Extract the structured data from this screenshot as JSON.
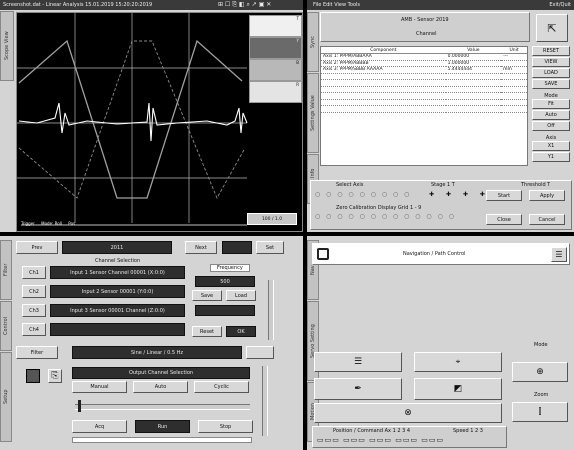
{
  "titlebar_left": {
    "title": "Screenshot.dat - Linear Analysis 15.01.2019 15:20:20:2019"
  },
  "titlebar_right": {
    "title": "File Edit View Tools",
    "right_label": "Exit/Quit"
  },
  "scope": {
    "side_tab": "Scope View",
    "legend": [
      "T",
      "Y",
      "B",
      "R"
    ],
    "colors": {
      "screen": "#000000",
      "grid": "#b8b8b8",
      "trace": "#ffffff",
      "ramp": "#a0a0a0"
    },
    "status_left": "Trigger  ...  Mode: Roll  ...  Pos",
    "zoom_label": "100 / 1.0"
  },
  "table_panel": {
    "side_tabs": [
      "Sync",
      "Settings Value",
      "Plot Info"
    ],
    "header_title": "AMB - Sensor 2019",
    "header_sub": "Channel",
    "columns": [
      "Component",
      "Value",
      "Unit"
    ],
    "rows": [
      {
        "c": "Axis 1: PPPM/ABBAAA",
        "v": "0.000000",
        "u": "---"
      },
      {
        "c": "Axis 2: PPPM/ABBBB",
        "v": "1.000000",
        "u": ""
      },
      {
        "c": "Axis 3: PPPM/SBBB AAAAA",
        "v": "5.4444444",
        "u": "mm"
      },
      {
        "c": "",
        "v": "",
        "u": ""
      },
      {
        "c": "",
        "v": "",
        "u": ""
      },
      {
        "c": "",
        "v": "",
        "u": ""
      },
      {
        "c": "",
        "v": "",
        "u": ""
      },
      {
        "c": "",
        "v": "",
        "u": ""
      },
      {
        "c": "",
        "v": "",
        "u": ""
      }
    ],
    "right_buttons": [
      "RESET",
      "VIEW",
      "LOAD",
      "SAVE"
    ],
    "right_group1": [
      "Mode",
      "Fit",
      "Auto",
      "Off"
    ],
    "right_group2": [
      "Axis",
      "X1",
      "Y1"
    ],
    "bottom_group_labels": [
      "Select Axis",
      "Stage 1 T",
      "Threshold T"
    ],
    "bottom_row_label": "Zero Calibration  Display  Grid 1 - 9",
    "bottom_buttons": [
      "Start",
      "Apply",
      "Close",
      "Cancel"
    ]
  },
  "control_panel": {
    "side_tabs": [
      "Filter",
      "Control",
      "Setup"
    ],
    "top_value": "2011",
    "top_buttons": [
      "Prev",
      "Next",
      "Set"
    ],
    "section_title": "Channel Selection",
    "channel_rows": [
      {
        "key": "Ch1",
        "value": "Input 1 Sensor Channel 00001 (X:0:0)"
      },
      {
        "key": "Ch2",
        "value": "Input 2 Sensor 00001 (Y:0:0)"
      },
      {
        "key": "Ch3",
        "value": "Input 3 Sensor 00001 Channel (Z:0:0)"
      },
      {
        "key": "Ch4",
        "value": ""
      }
    ],
    "freq_label": "Frequency",
    "freq_value": "500",
    "mini_buttons": [
      "Save",
      "Load",
      "Reset",
      "OK"
    ],
    "filter_label": "Filter",
    "filter_value": "Sine / Linear / 0.5 Hz",
    "output_label": "Output Channel Selection",
    "output_buttons": [
      "Manual",
      "Auto",
      "Cyclic"
    ],
    "bottom_buttons": [
      "Acq",
      "Run",
      "Stop"
    ]
  },
  "nav_panel": {
    "side_tabs": [
      "Nav",
      "Servo Setting",
      "Motion"
    ],
    "title": "Navigation / Path Control",
    "group_labels": [
      "Mode",
      "Zoom"
    ],
    "status_labels": [
      "Position / Command  Ax 1 2 3 4",
      "Speed 1 2 3"
    ],
    "status_values": [
      "0.00",
      "0.00",
      "0.00",
      "0.00"
    ]
  }
}
